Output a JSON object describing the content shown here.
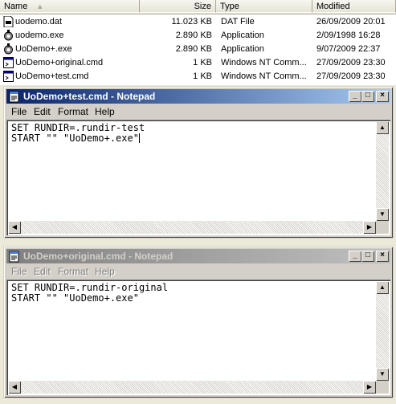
{
  "explorer": {
    "columns": {
      "name": "Name",
      "size": "Size",
      "type": "Type",
      "modified": "Modified"
    },
    "rows": [
      {
        "name": "uodemo.dat",
        "size": "11.023 KB",
        "type": "DAT File",
        "modified": "26/09/2009 20:01",
        "icon": "dat-file-icon"
      },
      {
        "name": "uodemo.exe",
        "size": "2.890 KB",
        "type": "Application",
        "modified": "2/09/1998 16:28",
        "icon": "exe-icon"
      },
      {
        "name": "UoDemo+.exe",
        "size": "2.890 KB",
        "type": "Application",
        "modified": "9/07/2009 22:37",
        "icon": "exe-icon"
      },
      {
        "name": "UoDemo+original.cmd",
        "size": "1 KB",
        "type": "Windows NT Comm...",
        "modified": "27/09/2009 23:30",
        "icon": "cmd-file-icon"
      },
      {
        "name": "UoDemo+test.cmd",
        "size": "1 KB",
        "type": "Windows NT Comm...",
        "modified": "27/09/2009 23:30",
        "icon": "cmd-file-icon"
      }
    ]
  },
  "notepad_top": {
    "title": "UoDemo+test.cmd - Notepad",
    "menu": {
      "file": "File",
      "edit": "Edit",
      "format": "Format",
      "help": "Help"
    },
    "lines": [
      "SET RUNDIR=.rundir-test",
      "START \"\" \"UoDemo+.exe\""
    ]
  },
  "notepad_bottom": {
    "title": "UoDemo+original.cmd - Notepad",
    "menu": {
      "file": "File",
      "edit": "Edit",
      "format": "Format",
      "help": "Help"
    },
    "lines": [
      "SET RUNDIR=.rundir-original",
      "START \"\" \"UoDemo+.exe\""
    ]
  }
}
